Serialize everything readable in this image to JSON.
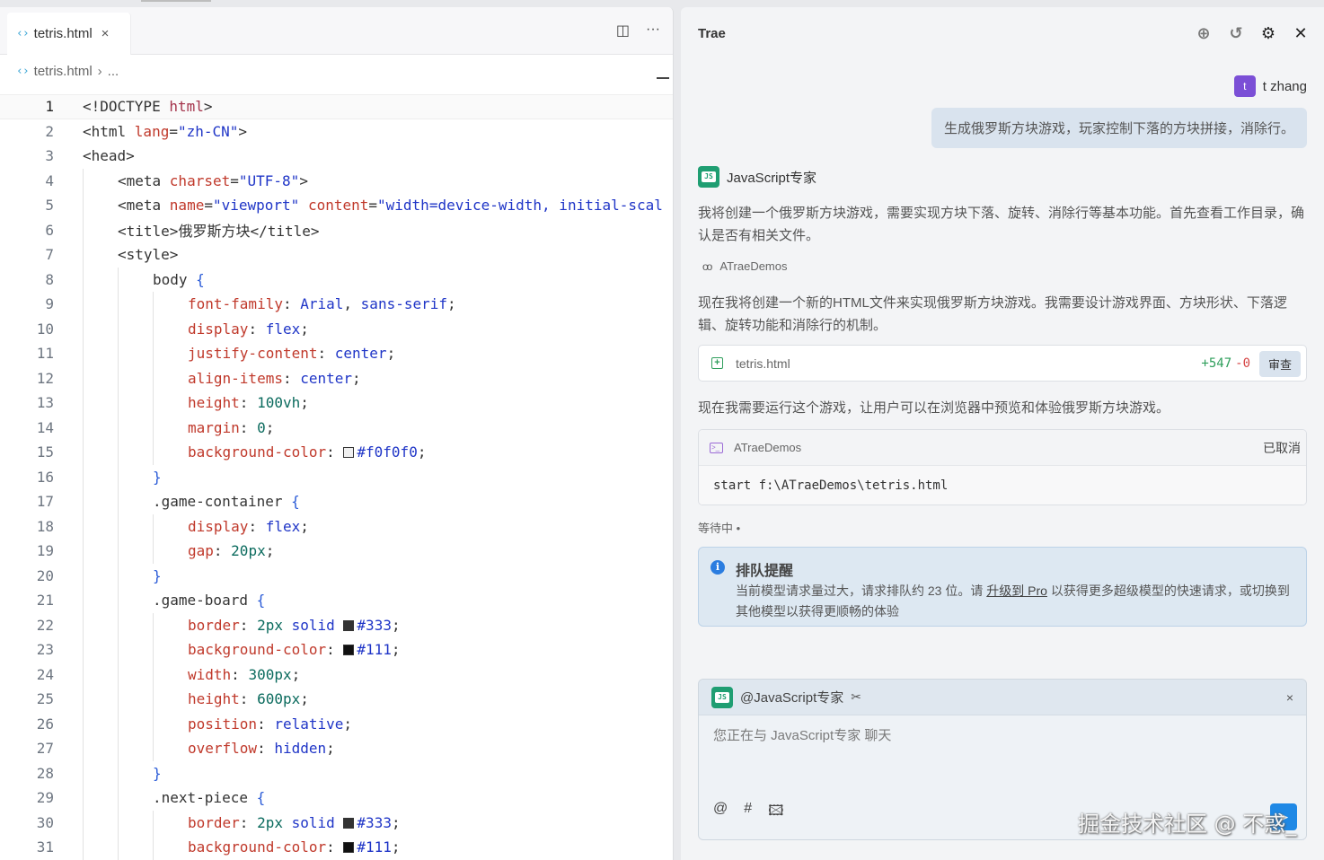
{
  "editor": {
    "tab_label": "tetris.html",
    "tab_close": "×",
    "code_glyph": "‹›",
    "breadcrumb": {
      "file": "tetris.html",
      "sep": "›",
      "more": "..."
    },
    "actions": {
      "split": "◫",
      "more": "···"
    },
    "lines": [
      {
        "n": "1",
        "indent": 0,
        "html": "<span class='t-tag'>&lt;!DOCTYPE </span><span class='t-name'>html</span><span class='t-tag'>&gt;</span>"
      },
      {
        "n": "2",
        "indent": 0,
        "html": "<span class='t-tag'>&lt;html </span><span class='t-attr'>lang</span>=<span class='t-str'>\"zh-CN\"</span><span class='t-tag'>&gt;</span>"
      },
      {
        "n": "3",
        "indent": 0,
        "html": "<span class='t-tag'>&lt;head&gt;</span>"
      },
      {
        "n": "4",
        "indent": 1,
        "html": "<span class='t-tag'>&lt;meta </span><span class='t-attr'>charset</span>=<span class='t-str'>\"UTF-8\"</span><span class='t-tag'>&gt;</span>"
      },
      {
        "n": "5",
        "indent": 1,
        "html": "<span class='t-tag'>&lt;meta </span><span class='t-attr'>name</span>=<span class='t-str'>\"viewport\"</span> <span class='t-attr'>content</span>=<span class='t-str'>\"width=device-width, initial-scal</span>"
      },
      {
        "n": "6",
        "indent": 1,
        "html": "<span class='t-tag'>&lt;title&gt;</span>俄罗斯方块<span class='t-tag'>&lt;/title&gt;</span>"
      },
      {
        "n": "7",
        "indent": 1,
        "html": "<span class='t-tag'>&lt;style&gt;</span>"
      },
      {
        "n": "8",
        "indent": 2,
        "html": "<span class='t-sel'>body </span><span class='t-brace'>{</span>"
      },
      {
        "n": "9",
        "indent": 3,
        "html": "<span class='t-prop'>font-family</span>: <span class='t-str'>Arial</span>, <span class='t-str'>sans-serif</span>;"
      },
      {
        "n": "10",
        "indent": 3,
        "html": "<span class='t-prop'>display</span>: <span class='t-str'>flex</span>;"
      },
      {
        "n": "11",
        "indent": 3,
        "html": "<span class='t-prop'>justify-content</span>: <span class='t-str'>center</span>;"
      },
      {
        "n": "12",
        "indent": 3,
        "html": "<span class='t-prop'>align-items</span>: <span class='t-str'>center</span>;"
      },
      {
        "n": "13",
        "indent": 3,
        "html": "<span class='t-prop'>height</span>: <span class='t-num'>100vh</span>;"
      },
      {
        "n": "14",
        "indent": 3,
        "html": "<span class='t-prop'>margin</span>: <span class='t-num'>0</span>;"
      },
      {
        "n": "15",
        "indent": 3,
        "html": "<span class='t-prop'>background-color</span>: <span class='swatch' style='background:#f0f0f0'></span><span class='t-str'>#f0f0f0</span>;"
      },
      {
        "n": "16",
        "indent": 2,
        "html": "<span class='t-brace'>}</span>"
      },
      {
        "n": "17",
        "indent": 2,
        "html": "<span class='t-sel'>.game-container </span><span class='t-brace'>{</span>"
      },
      {
        "n": "18",
        "indent": 3,
        "html": "<span class='t-prop'>display</span>: <span class='t-str'>flex</span>;"
      },
      {
        "n": "19",
        "indent": 3,
        "html": "<span class='t-prop'>gap</span>: <span class='t-num'>20px</span>;"
      },
      {
        "n": "20",
        "indent": 2,
        "html": "<span class='t-brace'>}</span>"
      },
      {
        "n": "21",
        "indent": 2,
        "html": "<span class='t-sel'>.game-board </span><span class='t-brace'>{</span>"
      },
      {
        "n": "22",
        "indent": 3,
        "html": "<span class='t-prop'>border</span>: <span class='t-num'>2px</span> <span class='t-str'>solid</span> <span class='swatch' style='background:#333'></span><span class='t-str'>#333</span>;"
      },
      {
        "n": "23",
        "indent": 3,
        "html": "<span class='t-prop'>background-color</span>: <span class='swatch' style='background:#111'></span><span class='t-str'>#111</span>;"
      },
      {
        "n": "24",
        "indent": 3,
        "html": "<span class='t-prop'>width</span>: <span class='t-num'>300px</span>;"
      },
      {
        "n": "25",
        "indent": 3,
        "html": "<span class='t-prop'>height</span>: <span class='t-num'>600px</span>;"
      },
      {
        "n": "26",
        "indent": 3,
        "html": "<span class='t-prop'>position</span>: <span class='t-str'>relative</span>;"
      },
      {
        "n": "27",
        "indent": 3,
        "html": "<span class='t-prop'>overflow</span>: <span class='t-str'>hidden</span>;"
      },
      {
        "n": "28",
        "indent": 2,
        "html": "<span class='t-brace'>}</span>"
      },
      {
        "n": "29",
        "indent": 2,
        "html": "<span class='t-sel'>.next-piece </span><span class='t-brace'>{</span>"
      },
      {
        "n": "30",
        "indent": 3,
        "html": "<span class='t-prop'>border</span>: <span class='t-num'>2px</span> <span class='t-str'>solid</span> <span class='swatch' style='background:#333'></span><span class='t-str'>#333</span>;"
      },
      {
        "n": "31",
        "indent": 3,
        "html": "<span class='t-prop'>background-color</span>: <span class='swatch' style='background:#111'></span><span class='t-str'>#111</span>;"
      }
    ]
  },
  "chat": {
    "title": "Trae",
    "icons": {
      "new_chat": "⊕",
      "history": "↺",
      "settings": "⚙",
      "close": "✕"
    },
    "user": {
      "avatar_letter": "t",
      "name": "t zhang",
      "message": "生成俄罗斯方块游戏，玩家控制下落的方块拼接，消除行。"
    },
    "agent": {
      "name": "JavaScript专家",
      "logo_text": "JS",
      "para1": "我将创建一个俄罗斯方块游戏，需要实现方块下落、旋转、消除行等基本功能。首先查看工作目录，确认是否有相关文件。",
      "folder_glyph": "oo",
      "folder": "ATraeDemos",
      "para2": "现在我将创建一个新的HTML文件来实现俄罗斯方块游戏。我需要设计游戏界面、方块形状、下落逻辑、旋转功能和消除行的机制。",
      "file_card": {
        "name": "tetris.html",
        "plus_glyph": "+",
        "added": "+547",
        "removed": "-0",
        "review_label": "审查"
      },
      "para3": "现在我需要运行这个游戏，让用户可以在浏览器中预览和体验俄罗斯方块游戏。",
      "terminal": {
        "glyph": ">_",
        "folder": "ATraeDemos",
        "status": "已取消",
        "command": "start f:\\ATraeDemos\\tetris.html"
      },
      "waiting": "等待中 •"
    },
    "notice": {
      "icon_glyph": "i",
      "title": "排队提醒",
      "body_before": "当前模型请求量过大，请求排队约 23 位。请 ",
      "link": "升级到 Pro",
      "body_after": " 以获得更多超级模型的快速请求，或切换到其他模型以获得更顺畅的体验"
    },
    "input": {
      "mention": "@JavaScript专家",
      "tool_glyph": "✂",
      "close": "×",
      "placeholder": "您正在与 JavaScript专家 聊天",
      "tools": {
        "at": "@",
        "hash": "#",
        "image": "🖾"
      },
      "send_glyph": "➤"
    }
  },
  "watermark": "掘金技术社区 @ 不惑_"
}
